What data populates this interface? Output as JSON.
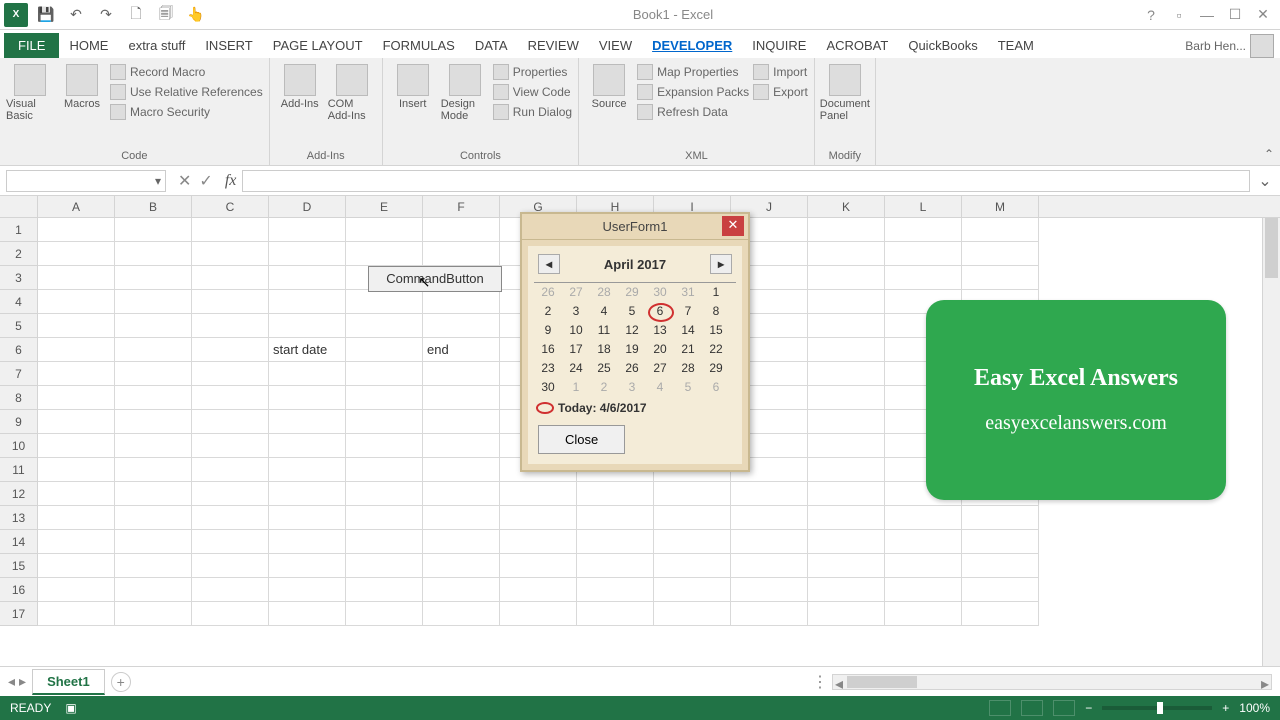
{
  "title": "Book1 - Excel",
  "qat": {
    "save": "💾",
    "undo": "↶",
    "redo": "↷",
    "new": "🗋",
    "open": "🗐",
    "touch": "👆"
  },
  "tabs": [
    "FILE",
    "HOME",
    "extra stuff",
    "INSERT",
    "PAGE LAYOUT",
    "FORMULAS",
    "DATA",
    "REVIEW",
    "VIEW",
    "DEVELOPER",
    "INQUIRE",
    "ACROBAT",
    "QuickBooks",
    "TEAM"
  ],
  "active_tab": "DEVELOPER",
  "user_name": "Barb Hen...",
  "ribbon": {
    "code": {
      "label": "Code",
      "visual_basic": "Visual Basic",
      "macros": "Macros",
      "record": "Record Macro",
      "relative": "Use Relative References",
      "security": "Macro Security"
    },
    "addins": {
      "label": "Add-Ins",
      "addins": "Add-Ins",
      "com": "COM Add-Ins"
    },
    "controls": {
      "label": "Controls",
      "insert": "Insert",
      "design": "Design Mode",
      "properties": "Properties",
      "view_code": "View Code",
      "run_dialog": "Run Dialog"
    },
    "xml": {
      "label": "XML",
      "source": "Source",
      "map_props": "Map Properties",
      "expansion": "Expansion Packs",
      "refresh": "Refresh Data",
      "import": "Import",
      "export": "Export"
    },
    "modify": {
      "label": "Modify",
      "doc_panel": "Document Panel"
    }
  },
  "columns": [
    "A",
    "B",
    "C",
    "D",
    "E",
    "F",
    "G",
    "H",
    "I",
    "J",
    "K",
    "L",
    "M"
  ],
  "row_count": 17,
  "sheet_button": "CommandButton",
  "cell_labels": {
    "start_date": "start date",
    "end_date": "end"
  },
  "userform": {
    "title": "UserForm1",
    "month": "April 2017",
    "weeks": [
      [
        {
          "d": "26",
          "g": true
        },
        {
          "d": "27",
          "g": true
        },
        {
          "d": "28",
          "g": true
        },
        {
          "d": "29",
          "g": true
        },
        {
          "d": "30",
          "g": true
        },
        {
          "d": "31",
          "g": true
        },
        {
          "d": "1"
        }
      ],
      [
        {
          "d": "2"
        },
        {
          "d": "3"
        },
        {
          "d": "4"
        },
        {
          "d": "5"
        },
        {
          "d": "6",
          "t": true
        },
        {
          "d": "7"
        },
        {
          "d": "8"
        }
      ],
      [
        {
          "d": "9"
        },
        {
          "d": "10"
        },
        {
          "d": "11"
        },
        {
          "d": "12"
        },
        {
          "d": "13"
        },
        {
          "d": "14"
        },
        {
          "d": "15"
        }
      ],
      [
        {
          "d": "16"
        },
        {
          "d": "17"
        },
        {
          "d": "18"
        },
        {
          "d": "19"
        },
        {
          "d": "20"
        },
        {
          "d": "21"
        },
        {
          "d": "22"
        }
      ],
      [
        {
          "d": "23"
        },
        {
          "d": "24"
        },
        {
          "d": "25"
        },
        {
          "d": "26"
        },
        {
          "d": "27"
        },
        {
          "d": "28"
        },
        {
          "d": "29"
        }
      ],
      [
        {
          "d": "30"
        },
        {
          "d": "1",
          "g": true
        },
        {
          "d": "2",
          "g": true
        },
        {
          "d": "3",
          "g": true
        },
        {
          "d": "4",
          "g": true
        },
        {
          "d": "5",
          "g": true
        },
        {
          "d": "6",
          "g": true
        }
      ]
    ],
    "today": "Today: 4/6/2017",
    "close": "Close"
  },
  "badge": {
    "line1": "Easy Excel Answers",
    "line2": "easyexcelanswers.com"
  },
  "sheet_tab": "Sheet1",
  "status": {
    "ready": "READY",
    "zoom": "100%"
  }
}
